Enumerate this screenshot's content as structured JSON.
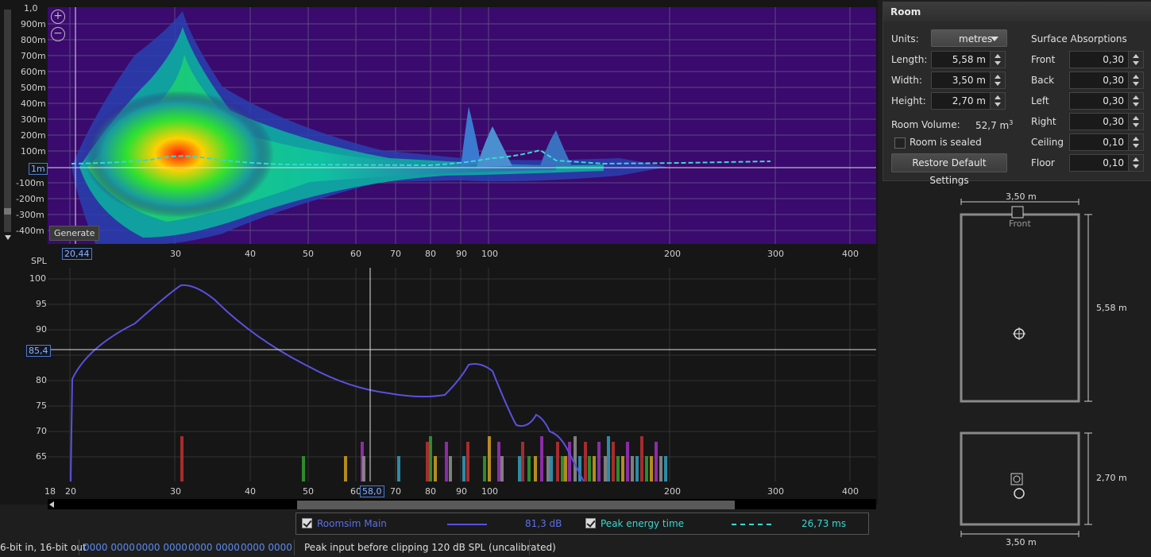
{
  "spectrogram": {
    "y_labels": [
      "1,0",
      "900m",
      "800m",
      "700m",
      "600m",
      "500m",
      "400m",
      "300m",
      "200m",
      "100m",
      "1m",
      "-100m",
      "-200m",
      "-300m",
      "-400m"
    ],
    "cursor_value": "1m",
    "x_cursor_value": "20,44",
    "x_labels": [
      "30",
      "40",
      "50",
      "60",
      "70",
      "80",
      "90",
      "100",
      "200",
      "300",
      "400"
    ],
    "generate_label": "Generate",
    "zoom_in": "+",
    "zoom_out": "−"
  },
  "spl": {
    "y_title": "SPL",
    "y_labels": [
      "100",
      "95",
      "90",
      "80",
      "75",
      "70",
      "65"
    ],
    "cursor_value": "85,4",
    "x_cursor_value": "58,0",
    "x_labels": [
      "18",
      "20",
      "30",
      "40",
      "50",
      "60",
      "70",
      "80",
      "90",
      "100",
      "200",
      "300",
      "400"
    ]
  },
  "legend": {
    "series1_name": "Roomsim Main",
    "series1_value": "81,3 dB",
    "series2_name": "Peak energy time",
    "series2_value": "26,73 ms"
  },
  "status": {
    "bits": "6-bit in, 16-bit out",
    "codes": [
      "0000 0000",
      "0000 0000",
      "0000 0000",
      "0000 0000"
    ],
    "peak": "Peak input before clipping 120 dB SPL (uncalibrated)"
  },
  "room": {
    "title": "Room",
    "units_label": "Units:",
    "units_value": "metres",
    "length_label": "Length:",
    "length_value": "5,58 m",
    "width_label": "Width:",
    "width_value": "3,50 m",
    "height_label": "Height:",
    "height_value": "2,70 m",
    "volume_label": "Room Volume:",
    "volume_value": "52,7 m",
    "volume_unit_sup": "3",
    "sealed_label": "Room is sealed",
    "restore_label": "Restore Default Settings",
    "absorptions_title": "Surface Absorptions",
    "absorptions": [
      {
        "label": "Front",
        "value": "0,30"
      },
      {
        "label": "Back",
        "value": "0,30"
      },
      {
        "label": "Left",
        "value": "0,30"
      },
      {
        "label": "Right",
        "value": "0,30"
      },
      {
        "label": "Ceiling",
        "value": "0,10"
      },
      {
        "label": "Floor",
        "value": "0,10"
      }
    ]
  },
  "plan": {
    "top_width": "3,50 m",
    "front_label": "Front",
    "side_length": "5,58 m",
    "elev_height": "2,70 m",
    "elev_width": "3,50 m"
  },
  "colors": {
    "spectro_bg": "#3a0a6e",
    "spl_line": "#5a50e0",
    "peak_line": "#38d8d0",
    "accent_box": "#4a7bd0"
  }
}
